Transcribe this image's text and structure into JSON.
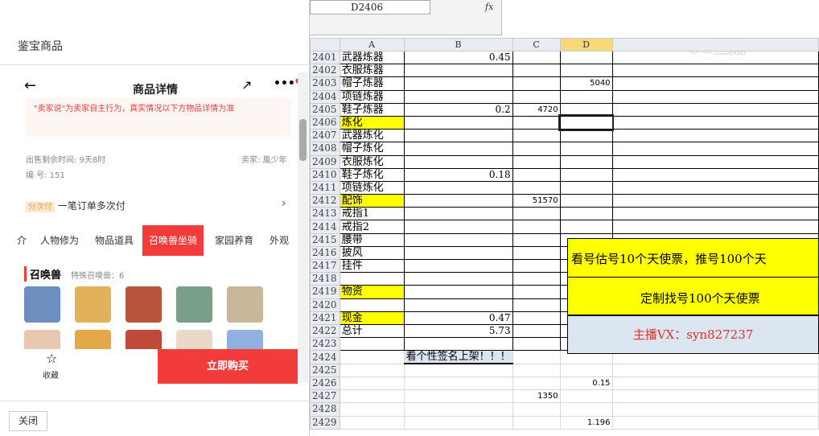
{
  "left": {
    "page_title": "鉴宝商品",
    "header_title": "商品详情",
    "notice": "\"卖家说\"为卖家自主行为，真实情况以下方物品详情为准",
    "remaining_time": "出售剩余时间: 9天8时",
    "seller": "卖家: 風少年",
    "serial": "编 号: 151",
    "pay_badge": "分次付",
    "pay_text": "一笔订单多次付",
    "tabs": [
      "介",
      "人物修为",
      "物品道具",
      "召唤兽坐骑",
      "家园养育",
      "外观"
    ],
    "section_title": "召唤兽",
    "section_sub": "特殊召唤兽：6",
    "favorite": "收藏",
    "buy": "立即购买",
    "close": "关闭"
  },
  "sheet": {
    "name_box": "D2406",
    "fx": "fx",
    "columns": [
      "A",
      "B",
      "C",
      "D"
    ],
    "rows": [
      {
        "n": "2401",
        "a": "武器炼器",
        "b": "0.45",
        "c": "",
        "d": ""
      },
      {
        "n": "2402",
        "a": "衣服炼器",
        "b": "",
        "c": "",
        "d": ""
      },
      {
        "n": "2403",
        "a": "帽子炼器",
        "b": "",
        "c": "",
        "d": "5040"
      },
      {
        "n": "2404",
        "a": "项链炼器",
        "b": "",
        "c": "",
        "d": ""
      },
      {
        "n": "2405",
        "a": "鞋子炼器",
        "b": "0.2",
        "c": "4720",
        "d": ""
      },
      {
        "n": "2406",
        "a": "炼化",
        "b": "",
        "c": "",
        "d": "",
        "y": true
      },
      {
        "n": "2407",
        "a": "武器炼化",
        "b": "",
        "c": "",
        "d": ""
      },
      {
        "n": "2408",
        "a": "帽子炼化",
        "b": "",
        "c": "",
        "d": ""
      },
      {
        "n": "2409",
        "a": "衣服炼化",
        "b": "",
        "c": "",
        "d": ""
      },
      {
        "n": "2410",
        "a": "鞋子炼化",
        "b": "0.18",
        "c": "",
        "d": ""
      },
      {
        "n": "2411",
        "a": "项链炼化",
        "b": "",
        "c": "",
        "d": ""
      },
      {
        "n": "2412",
        "a": "配饰",
        "b": "",
        "c": "51570",
        "d": "",
        "y": true
      },
      {
        "n": "2413",
        "a": "戒指1",
        "b": "",
        "c": "",
        "d": ""
      },
      {
        "n": "2414",
        "a": "戒指2",
        "b": "",
        "c": "",
        "d": ""
      },
      {
        "n": "2415",
        "a": "腰带",
        "b": "",
        "c": "",
        "d": ""
      },
      {
        "n": "2416",
        "a": "披风",
        "b": "",
        "c": "",
        "d": ""
      },
      {
        "n": "2417",
        "a": "挂件",
        "b": "",
        "c": "",
        "d": ""
      },
      {
        "n": "2418",
        "a": "",
        "b": "",
        "c": "",
        "d": ""
      },
      {
        "n": "2419",
        "a": "物资",
        "b": "",
        "c": "",
        "d": "",
        "y": true
      },
      {
        "n": "2420",
        "a": "",
        "b": "",
        "c": "",
        "d": ""
      },
      {
        "n": "2421",
        "a": "现金",
        "b": "0.47",
        "c": "",
        "d": "",
        "y": true
      },
      {
        "n": "2422",
        "a": "总计",
        "b": "5.73",
        "c": "",
        "d": ""
      },
      {
        "n": "2423",
        "a": "",
        "b": "",
        "c": "",
        "d": ""
      },
      {
        "n": "2424",
        "a": "",
        "b": "看个性签名上架！！！",
        "c": "",
        "d": ""
      },
      {
        "n": "2425",
        "a": "",
        "b": "",
        "c": "",
        "d": ""
      },
      {
        "n": "2426",
        "a": "",
        "b": "",
        "c": "",
        "d": "0.15"
      },
      {
        "n": "2427",
        "a": "",
        "b": "",
        "c": "1350",
        "d": ""
      },
      {
        "n": "2428",
        "a": "",
        "b": "",
        "c": "",
        "d": ""
      },
      {
        "n": "2429",
        "a": "",
        "b": "",
        "c": "",
        "d": "1.196"
      }
    ],
    "ad_line1": "看号估号10个天使票，推号100个天",
    "ad_line2": "定制找号100个天使票",
    "ad_contact": "主播VX：syn827237",
    "logo": "CC直播"
  }
}
